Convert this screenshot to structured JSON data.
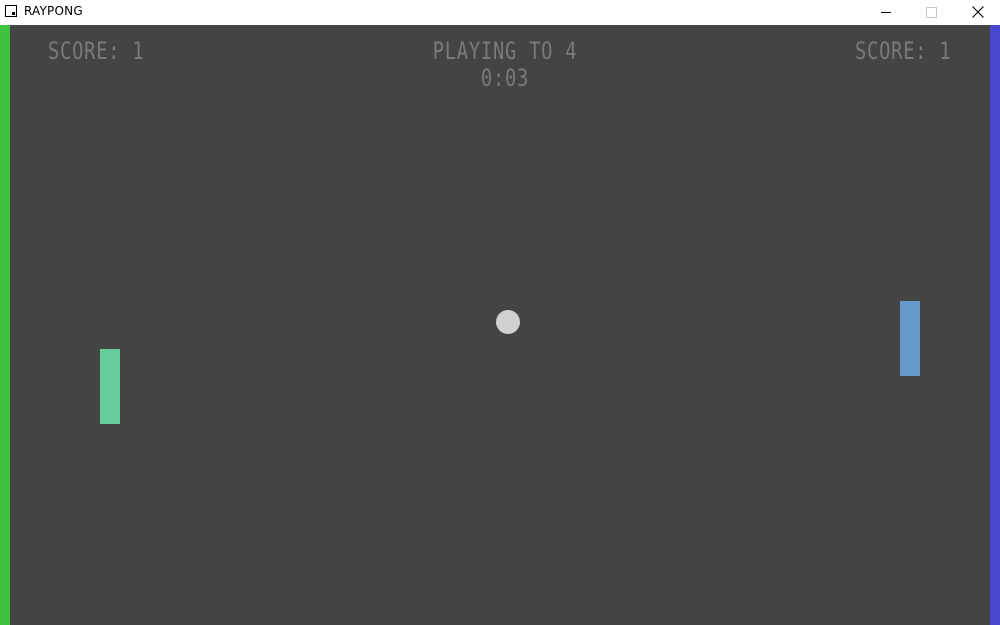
{
  "window": {
    "title": "RAYPONG",
    "icon": "raylib-app-icon",
    "controls": {
      "minimize": "minimize-icon",
      "maximize": "maximize-icon",
      "close": "close-icon"
    }
  },
  "hud": {
    "left_score": "SCORE: 1",
    "right_score": "SCORE: 1",
    "target": "PLAYING TO 4",
    "timer": "0:03"
  },
  "colors": {
    "background": "#444444",
    "hud_text": "#7a7a7a",
    "left_wall": "#3fc23f",
    "right_wall": "#4a47cf",
    "left_paddle": "#66cc99",
    "right_paddle": "#6699cc",
    "ball": "#d0d0d0"
  }
}
